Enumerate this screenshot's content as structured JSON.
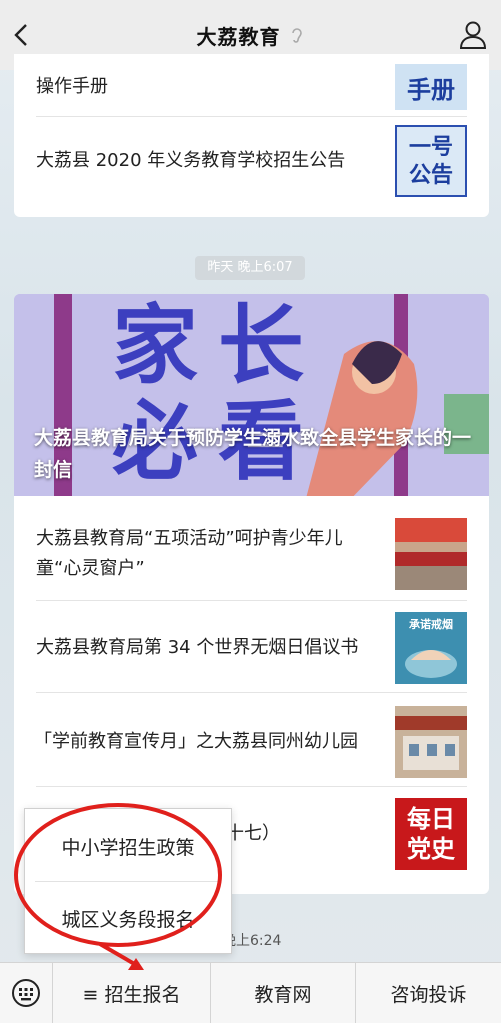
{
  "header": {
    "title": "大荔教育"
  },
  "top_card": {
    "items": [
      {
        "text": "操作手册",
        "thumb_text": "手册"
      },
      {
        "text": "大荔县 2020 年义务教育学校招生公告",
        "thumb_text_1": "一号",
        "thumb_text_2": "公告"
      }
    ]
  },
  "timestamp1": "昨天 晚上6:07",
  "article_card": {
    "hero_title": "大荔县教育局关于预防学生溺水致全县学生家长的一封信",
    "hero_image_text_1": "家长",
    "hero_image_text_2": "必看",
    "items": [
      {
        "text": "大荔县教育局“五项活动”呵护青少年儿童“心灵窗户”"
      },
      {
        "text": "大荔县教育局第 34 个世界无烟日倡议书",
        "thumb_text": "承诺戒烟"
      },
      {
        "text": "「学前教育宣传月」之大荔县同州幼儿园"
      },
      {
        "text": "十七）",
        "thumb_text_1": "每日",
        "thumb_text_2": "党史"
      }
    ]
  },
  "timestamp2": "晚上6:24",
  "popup": {
    "items": [
      "中小学招生政策",
      "城区义务段报名"
    ]
  },
  "bottom_bar": {
    "menu1": "≡ 招生报名",
    "menu2": "教育网",
    "menu3": "咨询投诉"
  }
}
